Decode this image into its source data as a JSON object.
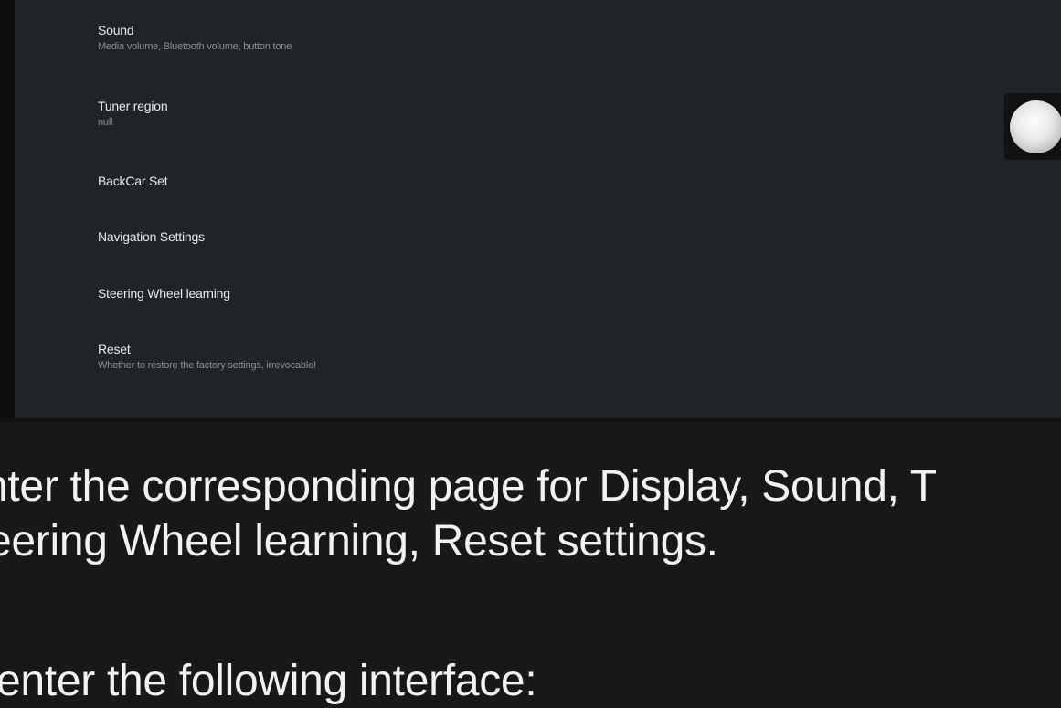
{
  "settings_menu": {
    "items": [
      {
        "title": "Sound",
        "subtitle": "Media volume, Bluetooth volume, button tone"
      },
      {
        "title": "Tuner region",
        "subtitle": "null"
      },
      {
        "title": "BackCar Set",
        "subtitle": ""
      },
      {
        "title": "Navigation Settings",
        "subtitle": ""
      },
      {
        "title": "Steering Wheel learning",
        "subtitle": ""
      },
      {
        "title": "Reset",
        "subtitle": "Whether to restore the factory settings, irrevocable!"
      }
    ],
    "toggle": {
      "state": "on"
    }
  },
  "manual_text": {
    "line1": "nter the corresponding page for Display, Sound, T",
    "line2": "eering Wheel learning, Reset settings.",
    "line3": "enter the following interface:"
  }
}
